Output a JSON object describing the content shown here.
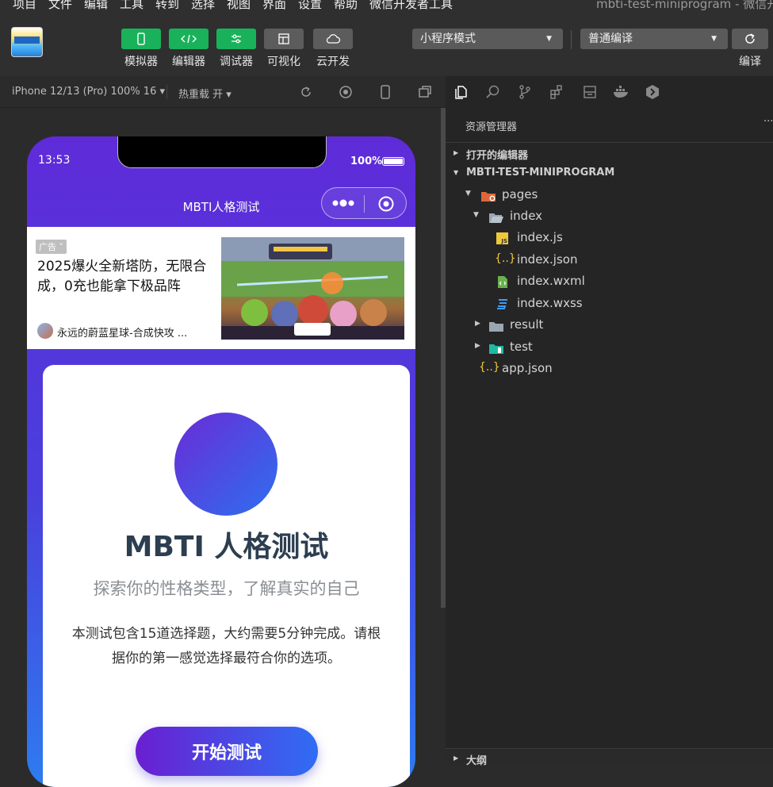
{
  "menubar": {
    "items": [
      "项目",
      "文件",
      "编辑",
      "工具",
      "转到",
      "选择",
      "视图",
      "界面",
      "设置",
      "帮助",
      "微信开发者工具"
    ],
    "window_title": "mbti-test-miniprogram - 微信开"
  },
  "toolbar": {
    "buttons": [
      "模拟器",
      "编辑器",
      "调试器",
      "可视化",
      "云开发"
    ],
    "mode_select": "小程序模式",
    "compile_select": "普通编译",
    "compile_label": "编译"
  },
  "simulator": {
    "device": "iPhone 12/13 (Pro) 100% 16 ▾",
    "hot_reload": "热重载 开 ▾"
  },
  "phone": {
    "time": "13:53",
    "battery": "100%",
    "nav_title": "MBTI人格测试",
    "ad": {
      "tag": "广告",
      "headline": "2025爆火全新塔防，无限合成，0充也能拿下极品阵",
      "source": "永远的蔚蓝星球-合成快攻 ..."
    },
    "card": {
      "title": "MBTI 人格测试",
      "subtitle": "探索你的性格类型，了解真实的自己",
      "description": "本测试包含15道选择题，大约需要5分钟完成。请根据你的第一感觉选择最符合你的选项。",
      "start_button": "开始测试"
    }
  },
  "explorer": {
    "title": "资源管理器",
    "open_editors": "打开的编辑器",
    "project": "MBTI-TEST-MINIPROGRAM",
    "tree": {
      "pages": "pages",
      "index": "index",
      "index_js": "index.js",
      "index_json": "index.json",
      "index_wxml": "index.wxml",
      "index_wxss": "index.wxss",
      "result": "result",
      "test": "test",
      "app_json": "app.json"
    },
    "outline": "大纲"
  },
  "colors": {
    "accent_green": "#19b25b",
    "phone_gradient_start": "#5f2bd9",
    "phone_gradient_end": "#2d7cf0"
  }
}
